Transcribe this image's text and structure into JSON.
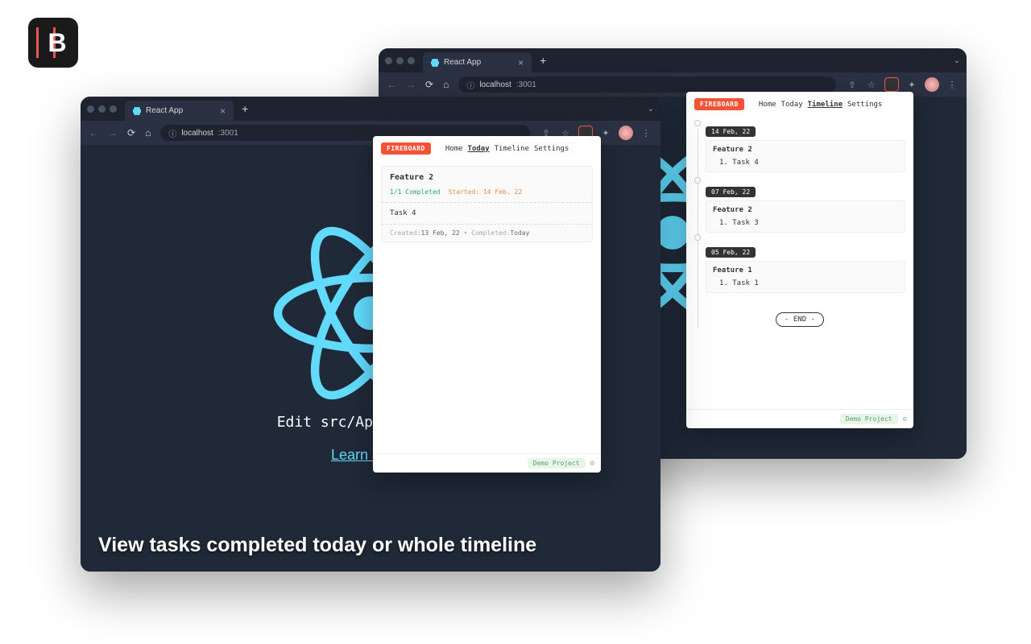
{
  "logo_letter": "B",
  "tab_title": "React App",
  "url": {
    "info_icon": "ⓘ",
    "host": "localhost",
    "port": ":3001"
  },
  "page": {
    "edit_text": "Edit src/App.js",
    "learn_link": "Learn React",
    "learn_link_visible_back": "arn React"
  },
  "caption": "View tasks completed today or whole timeline",
  "fireboard": {
    "badge": "FIREBOARD",
    "nav_home": "Home",
    "nav_today": "Today",
    "nav_timeline": "Timeline",
    "nav_settings": "Settings",
    "project_label": "Demo Project",
    "end_label": "- END -"
  },
  "today_view": {
    "feature_title": "Feature 2",
    "completion": "1/1 Completed",
    "started_label": "Started: 14 Feb, 22",
    "task_name": "Task 4",
    "created_label": "Created:",
    "created_value": "13 Feb, 22",
    "bullet": "•",
    "completed_label": "Completed:",
    "completed_value": "Today"
  },
  "timeline_view": {
    "entries": [
      {
        "date": "14 Feb, 22",
        "feature": "Feature 2",
        "task_idx": "1.",
        "task": "Task 4"
      },
      {
        "date": "07 Feb, 22",
        "feature": "Feature 2",
        "task_idx": "1.",
        "task": "Task 3"
      },
      {
        "date": "05 Feb, 22",
        "feature": "Feature 1",
        "task_idx": "1.",
        "task": "Task 1"
      }
    ]
  }
}
